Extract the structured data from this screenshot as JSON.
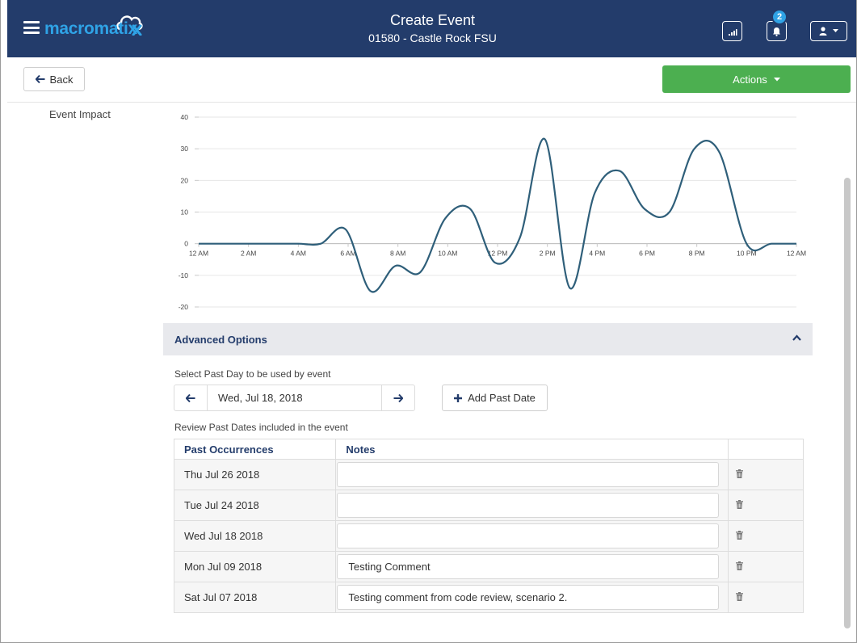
{
  "header": {
    "logo_text": "macromatix",
    "title": "Create Event",
    "subtitle": "01580 - Castle Rock FSU",
    "notification_count": "2"
  },
  "toolbar": {
    "back_label": "Back",
    "actions_label": "Actions"
  },
  "event_impact": {
    "label": "Event Impact"
  },
  "chart_data": {
    "type": "line",
    "title": "",
    "xlabel": "",
    "ylabel": "",
    "ylim": [
      -20,
      40
    ],
    "yticks": [
      -20,
      -10,
      0,
      10,
      20,
      30,
      40
    ],
    "xlim": [
      0,
      24
    ],
    "xtick_labels": [
      "12 AM",
      "2 AM",
      "4 AM",
      "6 AM",
      "8 AM",
      "10 AM",
      "12 PM",
      "2 PM",
      "4 PM",
      "6 PM",
      "8 PM",
      "10 PM",
      "12 AM"
    ],
    "grid": true,
    "legend": "none",
    "color": "#2f5f7a",
    "series": [
      {
        "x": [
          0,
          1,
          2,
          3,
          4,
          4.9,
          5.9,
          6.9,
          7.9,
          8.9,
          9.9,
          10.9,
          11.9,
          12.9,
          13.9,
          14.9,
          15.9,
          16.9,
          17.9,
          18.9,
          19.9,
          20.9,
          22,
          23,
          24
        ],
        "values": [
          0,
          0,
          0,
          0,
          0,
          0,
          4.5,
          -15,
          -7,
          -9,
          8,
          11,
          -6,
          2,
          33,
          -14,
          16,
          23,
          11,
          10,
          30,
          29,
          0,
          0,
          0
        ]
      }
    ]
  },
  "advanced": {
    "title": "Advanced Options",
    "select_label": "Select Past Day to be used by event",
    "selected_date": "Wed, Jul 18, 2018",
    "add_past_label": "Add Past Date",
    "review_label": "Review Past Dates included in the event",
    "table": {
      "col_past": "Past Occurrences",
      "col_notes": "Notes",
      "rows": [
        {
          "date": "Thu Jul 26 2018",
          "note": ""
        },
        {
          "date": "Tue Jul 24 2018",
          "note": ""
        },
        {
          "date": "Wed Jul 18 2018",
          "note": ""
        },
        {
          "date": "Mon Jul 09 2018",
          "note": "Testing Comment"
        },
        {
          "date": "Sat Jul 07 2018",
          "note": "Testing comment from code review, scenario 2."
        }
      ]
    }
  },
  "colors": {
    "header_bg": "#233c6b",
    "accent": "#2fa3e6",
    "actions_green": "#4caf50",
    "line": "#2f5f7a"
  },
  "icons": {
    "menu": "hamburger-icon",
    "signal": "signal-icon",
    "bell": "bell-icon",
    "user": "user-icon",
    "back": "arrow-left-icon",
    "caret": "caret-down-icon",
    "collapse": "chevron-up-icon",
    "prev": "arrow-left-icon",
    "next": "arrow-right-icon",
    "add": "plus-icon",
    "delete": "trash-icon"
  }
}
